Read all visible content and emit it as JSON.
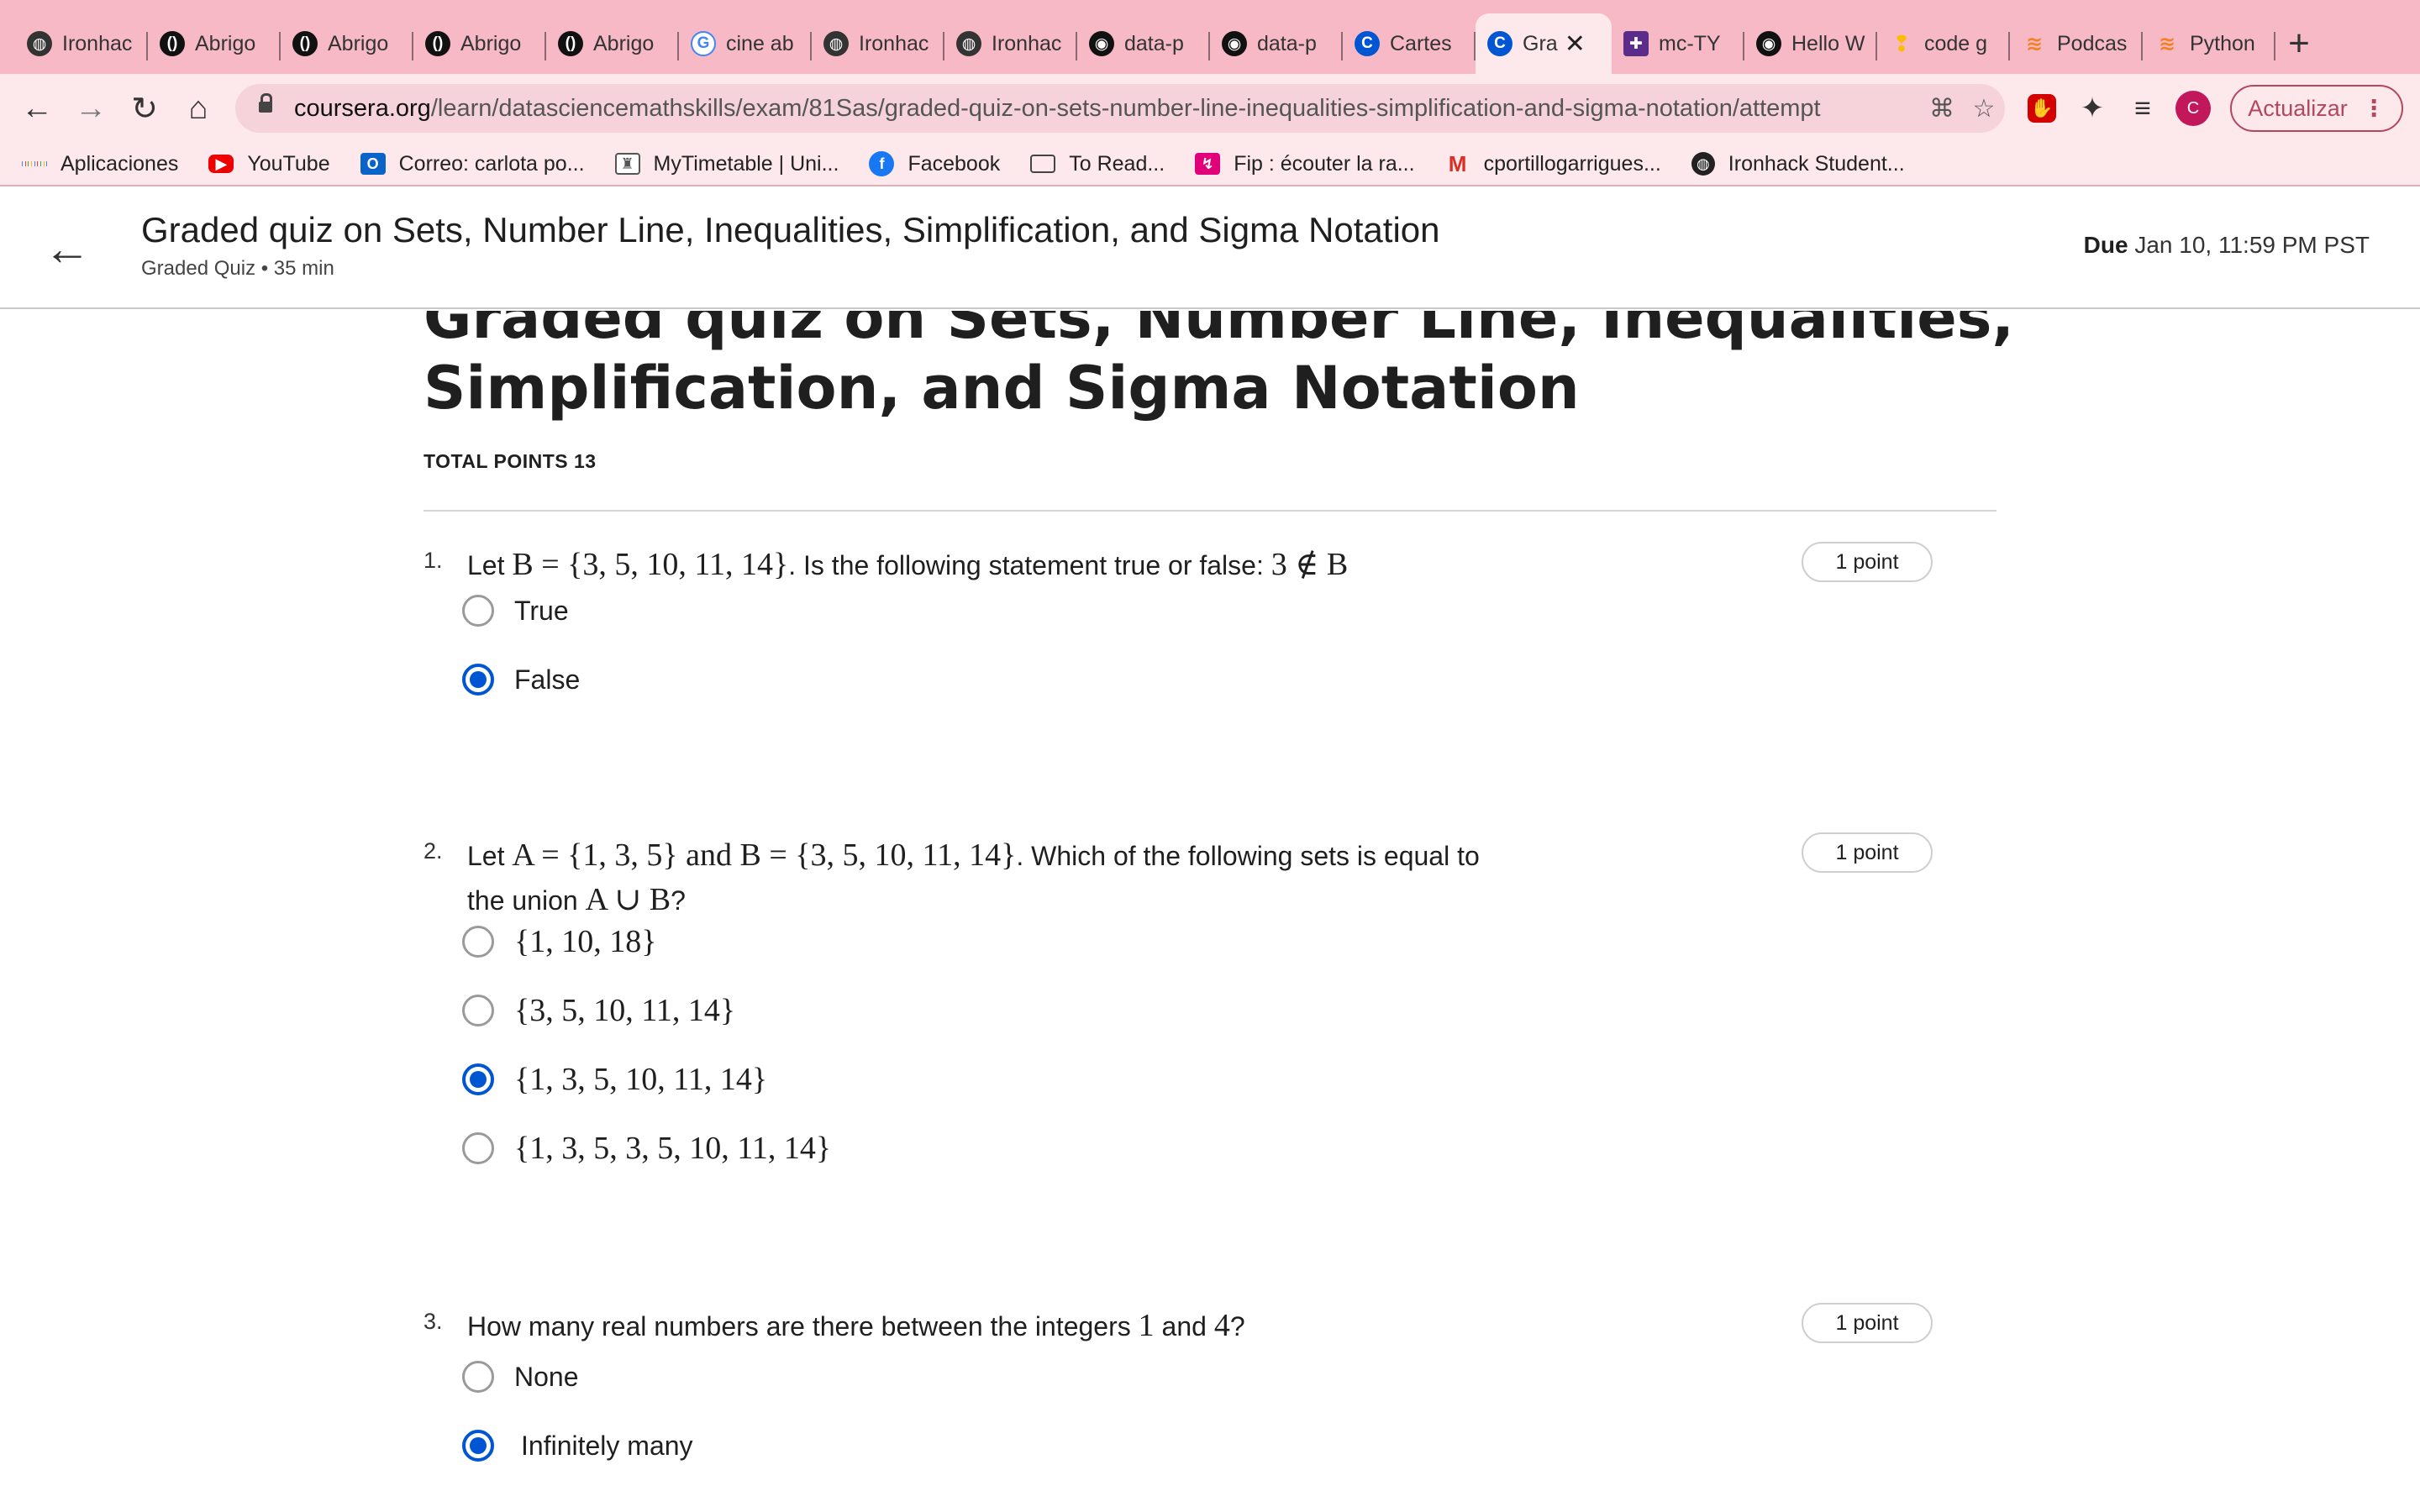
{
  "browser": {
    "tabs": [
      {
        "title": "Ironhac",
        "icon": "globe-icon",
        "color": "#333333"
      },
      {
        "title": "Abrigo",
        "icon": "brand-icon",
        "color": "#111111"
      },
      {
        "title": "Abrigo",
        "icon": "brand-icon",
        "color": "#111111"
      },
      {
        "title": "Abrigo",
        "icon": "brand-icon",
        "color": "#111111"
      },
      {
        "title": "Abrigo",
        "icon": "brand-icon",
        "color": "#111111"
      },
      {
        "title": "cine ab",
        "icon": "google-icon",
        "color": "#4285f4"
      },
      {
        "title": "Ironhac",
        "icon": "globe-icon",
        "color": "#333333"
      },
      {
        "title": "Ironhac",
        "icon": "globe-icon",
        "color": "#333333"
      },
      {
        "title": "data-p",
        "icon": "github-icon",
        "color": "#111111"
      },
      {
        "title": "data-p",
        "icon": "github-icon",
        "color": "#111111"
      },
      {
        "title": "Cartes",
        "icon": "coursera-icon",
        "color": "#0056d2"
      },
      {
        "title": "Gra",
        "icon": "coursera-icon",
        "color": "#0056d2",
        "active": true
      },
      {
        "title": "mc-TY",
        "icon": "shield-icon",
        "color": "#5b2c8a"
      },
      {
        "title": "Hello W",
        "icon": "github-icon",
        "color": "#111111"
      },
      {
        "title": "code g",
        "icon": "pin-icon",
        "color": "#fbbc05"
      },
      {
        "title": "Podcas",
        "icon": "stack-icon",
        "color": "#f48024"
      },
      {
        "title": "Python",
        "icon": "stack-icon",
        "color": "#f48024"
      }
    ],
    "url_host": "coursera.org",
    "url_path": "/learn/datasciencemathskills/exam/81Sas/graded-quiz-on-sets-number-line-inequalities-simplification-and-sigma-notation/attempt",
    "update_label": "Actualizar",
    "avatar_letter": "C",
    "bookmarks": [
      {
        "label": "Aplicaciones",
        "icon": "apps-grid-icon"
      },
      {
        "label": "YouTube",
        "icon": "youtube-icon"
      },
      {
        "label": "Correo: carlota po...",
        "icon": "outlook-icon"
      },
      {
        "label": "MyTimetable | Uni...",
        "icon": "crest-icon"
      },
      {
        "label": "Facebook",
        "icon": "facebook-icon"
      },
      {
        "label": "To Read...",
        "icon": "folder-icon"
      },
      {
        "label": "Fip : écouter la ra...",
        "icon": "fip-icon"
      },
      {
        "label": "cportillogarrigues...",
        "icon": "gmail-icon"
      },
      {
        "label": "Ironhack Student...",
        "icon": "globe-icon"
      }
    ]
  },
  "header": {
    "title": "Graded quiz on Sets, Number Line, Inequalities, Simplification, and Sigma Notation",
    "subtitle": "Graded Quiz • 35 min",
    "due_label": "Due",
    "due_value": "Jan 10, 11:59 PM PST"
  },
  "quiz": {
    "title": "Graded quiz on Sets, Number Line, Inequalities, Simplification, and Sigma Notation",
    "total_points": "TOTAL POINTS 13",
    "questions": [
      {
        "number": "1.",
        "points": "1 point",
        "text_a": "Let ",
        "math_a": "B = {3, 5, 10, 11, 14}",
        "text_b": ". Is the following statement true or false: ",
        "math_b": "3 ∉ B",
        "options": [
          {
            "label": "True",
            "selected": false
          },
          {
            "label": "False",
            "selected": true
          }
        ]
      },
      {
        "number": "2.",
        "points": "1 point",
        "text_a": "Let ",
        "math_a": "A = {1, 3, 5}",
        "text_b": " and ",
        "math_b": "B = {3, 5, 10, 11, 14}",
        "text_c": ". Which of the following sets is equal to the union ",
        "math_c": "A ∪ B",
        "text_d": "?",
        "options": [
          {
            "label": "{1, 10, 18}",
            "selected": false
          },
          {
            "label": "{3, 5, 10, 11, 14}",
            "selected": false
          },
          {
            "label": "{1, 3, 5, 10, 11, 14}",
            "selected": true
          },
          {
            "label": "{1, 3, 5, 3, 5, 10, 11, 14}",
            "selected": false
          }
        ]
      },
      {
        "number": "3.",
        "points": "1 point",
        "text_a": "How many real numbers are there between the integers ",
        "math_a": "1",
        "text_b": " and ",
        "math_b": "4",
        "text_c": "?",
        "options": [
          {
            "label": "None",
            "selected": false
          },
          {
            "label": "Infinitely many",
            "selected": true
          }
        ]
      }
    ]
  }
}
